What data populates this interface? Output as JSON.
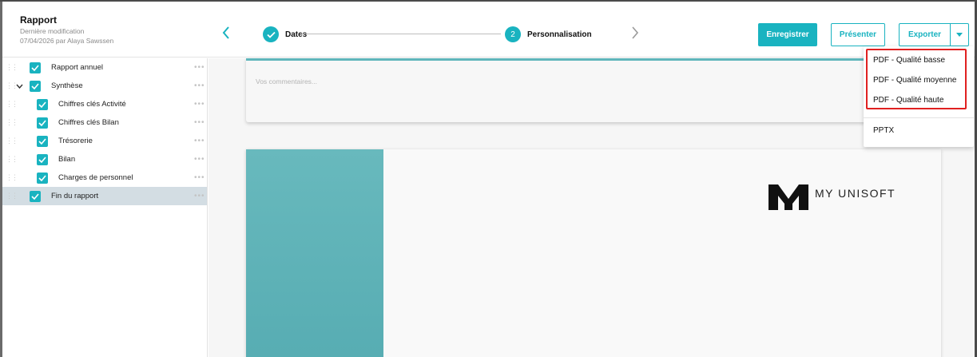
{
  "header": {
    "title": "Rapport",
    "last_modified_label": "Dernière modification",
    "last_modified_value": "07/04/2026 par Alaya Sawssen"
  },
  "stepper": {
    "steps": [
      {
        "number": "",
        "label": "Dates",
        "completed": true
      },
      {
        "number": "2",
        "label": "Personnalisation",
        "completed": false
      }
    ]
  },
  "toolbar": {
    "save_label": "Enregistrer",
    "present_label": "Présenter",
    "export_label": "Exporter"
  },
  "export_menu": {
    "items": [
      "PDF - Qualité basse",
      "PDF - Qualité moyenne",
      "PDF - Qualité haute",
      "PPTX"
    ]
  },
  "sidebar": {
    "items": [
      {
        "label": "Rapport annuel",
        "level": 0,
        "checked": true
      },
      {
        "label": "Synthèse",
        "level": 0,
        "checked": true,
        "expanded": true
      },
      {
        "label": "Chiffres clés Activité",
        "level": 1,
        "checked": true
      },
      {
        "label": "Chiffres clés Bilan",
        "level": 1,
        "checked": true
      },
      {
        "label": "Trésorerie",
        "level": 1,
        "checked": true
      },
      {
        "label": "Bilan",
        "level": 1,
        "checked": true
      },
      {
        "label": "Charges de personnel",
        "level": 1,
        "checked": true
      },
      {
        "label": "Fin du rapport",
        "level": 0,
        "checked": true,
        "selected": true
      }
    ]
  },
  "comment": {
    "placeholder": "Vos commentaires..."
  },
  "preview": {
    "brand_name": "MY UNISOFT"
  },
  "colors": {
    "accent": "#19b3c0",
    "highlight": "#e02020",
    "band": "#5fb1b6"
  }
}
